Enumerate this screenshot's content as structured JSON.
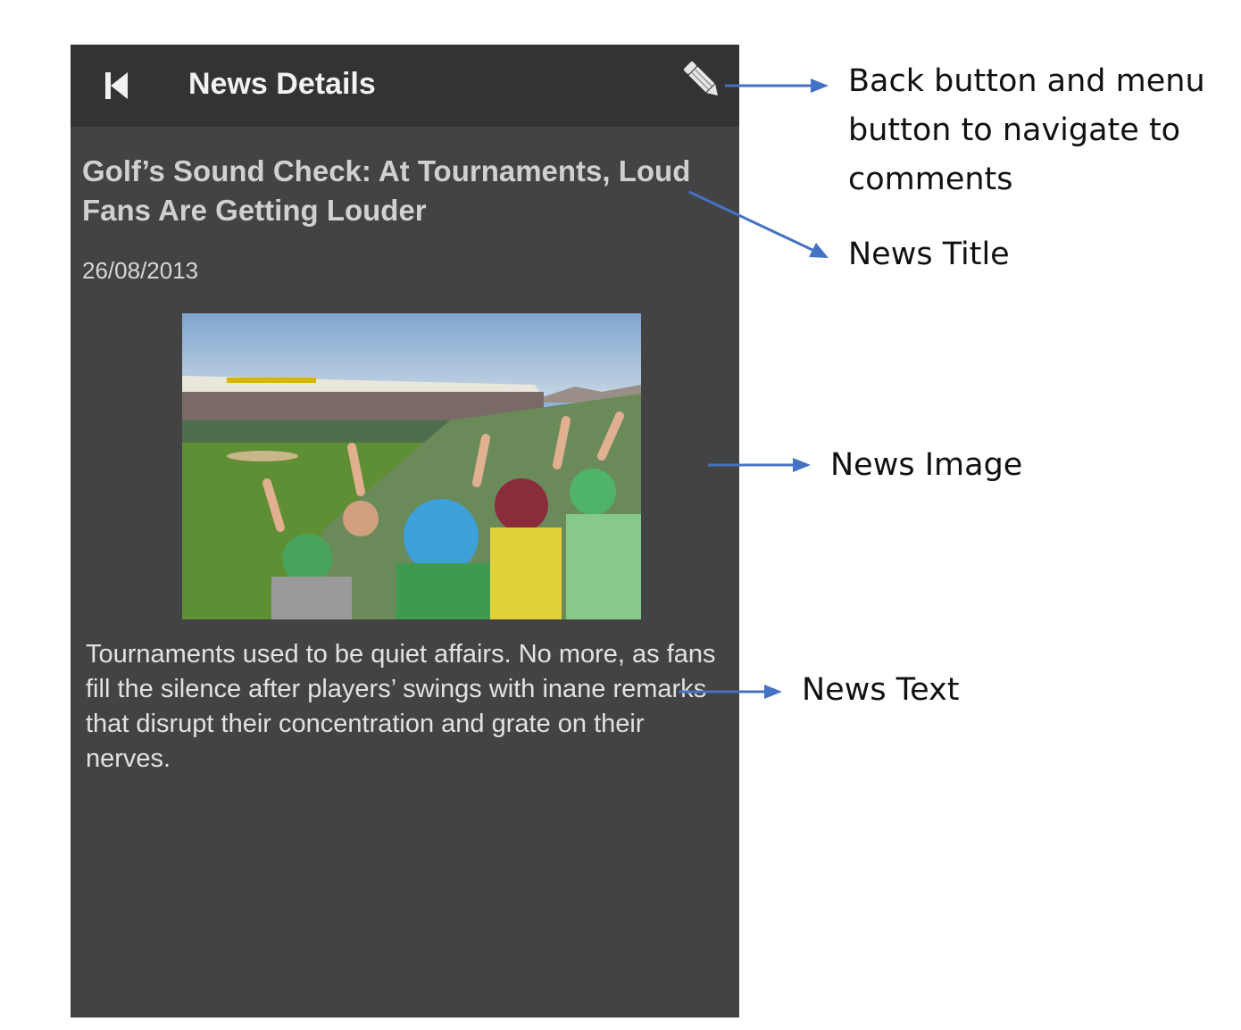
{
  "appbar": {
    "title": "News Details",
    "back_icon": "skip-previous-icon",
    "edit_icon": "pencil-icon"
  },
  "article": {
    "title": "Golf’s Sound Check: At Tournaments, Loud Fans Are Getting Louder",
    "date": "26/08/2013",
    "image_subject": "golf-crowd-photo",
    "text": "Tournaments used to be quiet affairs. No more, as fans fill the silence after players’ swings with inane remarks that disrupt their concentration and grate on their nerves."
  },
  "annotations": {
    "back_menu": "Back button and menu button to navigate to comments",
    "title": "News Title",
    "image": "News Image",
    "text": "News Text"
  },
  "colors": {
    "screen_bg": "#434343",
    "appbar_bg": "#333333",
    "arrow": "#4472c4"
  }
}
